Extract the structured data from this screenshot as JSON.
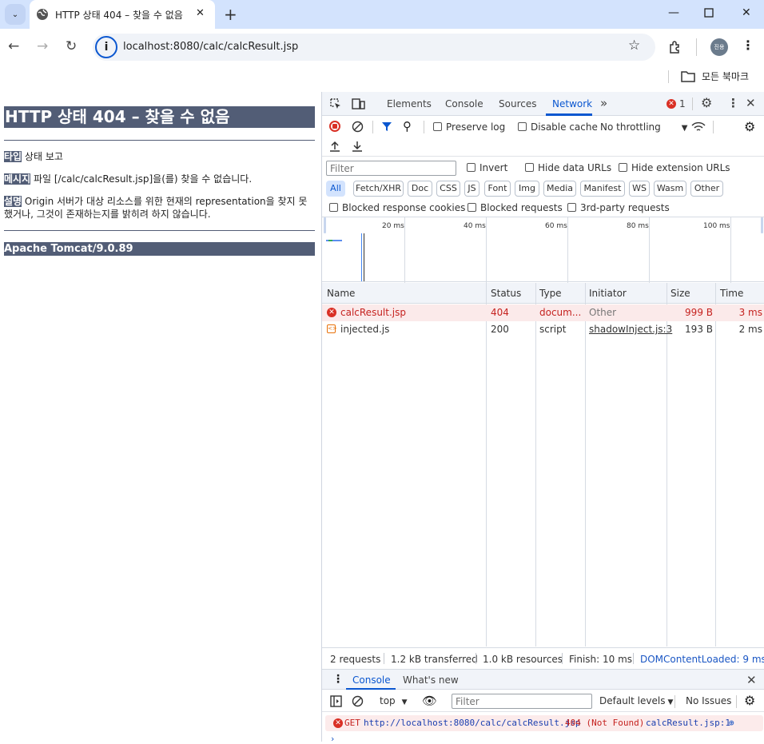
{
  "browser": {
    "tab_title": "HTTP 상태 404 – 찾을 수 없음",
    "url": "localhost:8080/calc/calcResult.jsp",
    "bookmarks_label": "모든 북마크",
    "profile_initials": "진용"
  },
  "page": {
    "heading": "HTTP 상태 404 – 찾을 수 없음",
    "type_label": "타입",
    "type_value": "상태 보고",
    "message_label": "메시지",
    "message_value": "파일 [/calc/calcResult.jsp]을(를) 찾을 수 없습니다.",
    "desc_label": "설명",
    "desc_value_line1": "Origin 서버가 대상 리소스를 위한 현재의 representation을 찾지 못",
    "desc_value_line2": "했거나, 그것이 존재하는지를 밝히려 하지 않습니다.",
    "footer": "Apache Tomcat/9.0.89"
  },
  "devtools": {
    "tabs": [
      "Elements",
      "Console",
      "Sources",
      "Network"
    ],
    "active_tab": "Network",
    "more_tabs": "»",
    "error_count": "1",
    "preserve_log": "Preserve log",
    "disable_cache": "Disable cache",
    "throttling": "No throttling",
    "filter_placeholder": "Filter",
    "invert": "Invert",
    "hide_data_urls": "Hide data URLs",
    "hide_extension_urls": "Hide extension URLs",
    "type_chips": [
      "All",
      "Fetch/XHR",
      "Doc",
      "CSS",
      "JS",
      "Font",
      "Img",
      "Media",
      "Manifest",
      "WS",
      "Wasm",
      "Other"
    ],
    "blocked_response_cookies": "Blocked response cookies",
    "blocked_requests": "Blocked requests",
    "third_party": "3rd-party requests",
    "timeline_ticks": [
      "20 ms",
      "40 ms",
      "60 ms",
      "80 ms",
      "100 ms"
    ],
    "columns": [
      "Name",
      "Status",
      "Type",
      "Initiator",
      "Size",
      "Time"
    ],
    "requests": [
      {
        "name": "calcResult.jsp",
        "status": "404",
        "type": "docum...",
        "initiator": "Other",
        "size": "999 B",
        "time": "3 ms"
      },
      {
        "name": "injected.js",
        "status": "200",
        "type": "script",
        "initiator": "shadowInject.js:3",
        "size": "193 B",
        "time": "2 ms"
      }
    ],
    "summary": {
      "requests": "2 requests",
      "transferred": "1.2 kB transferred",
      "resources": "1.0 kB resources",
      "finish": "Finish: 10 ms",
      "dcl": "DOMContentLoaded: 9 ms"
    },
    "drawer": {
      "tabs": [
        "Console",
        "What's new"
      ],
      "context": "top",
      "filter_placeholder": "Filter",
      "levels": "Default levels",
      "issues": "No Issues",
      "message": {
        "method": "GET",
        "url": "http://localhost:8080/calc/calcResult.jsp",
        "status": "404 (Not Found)",
        "source": "calcResult.jsp:1"
      }
    }
  }
}
